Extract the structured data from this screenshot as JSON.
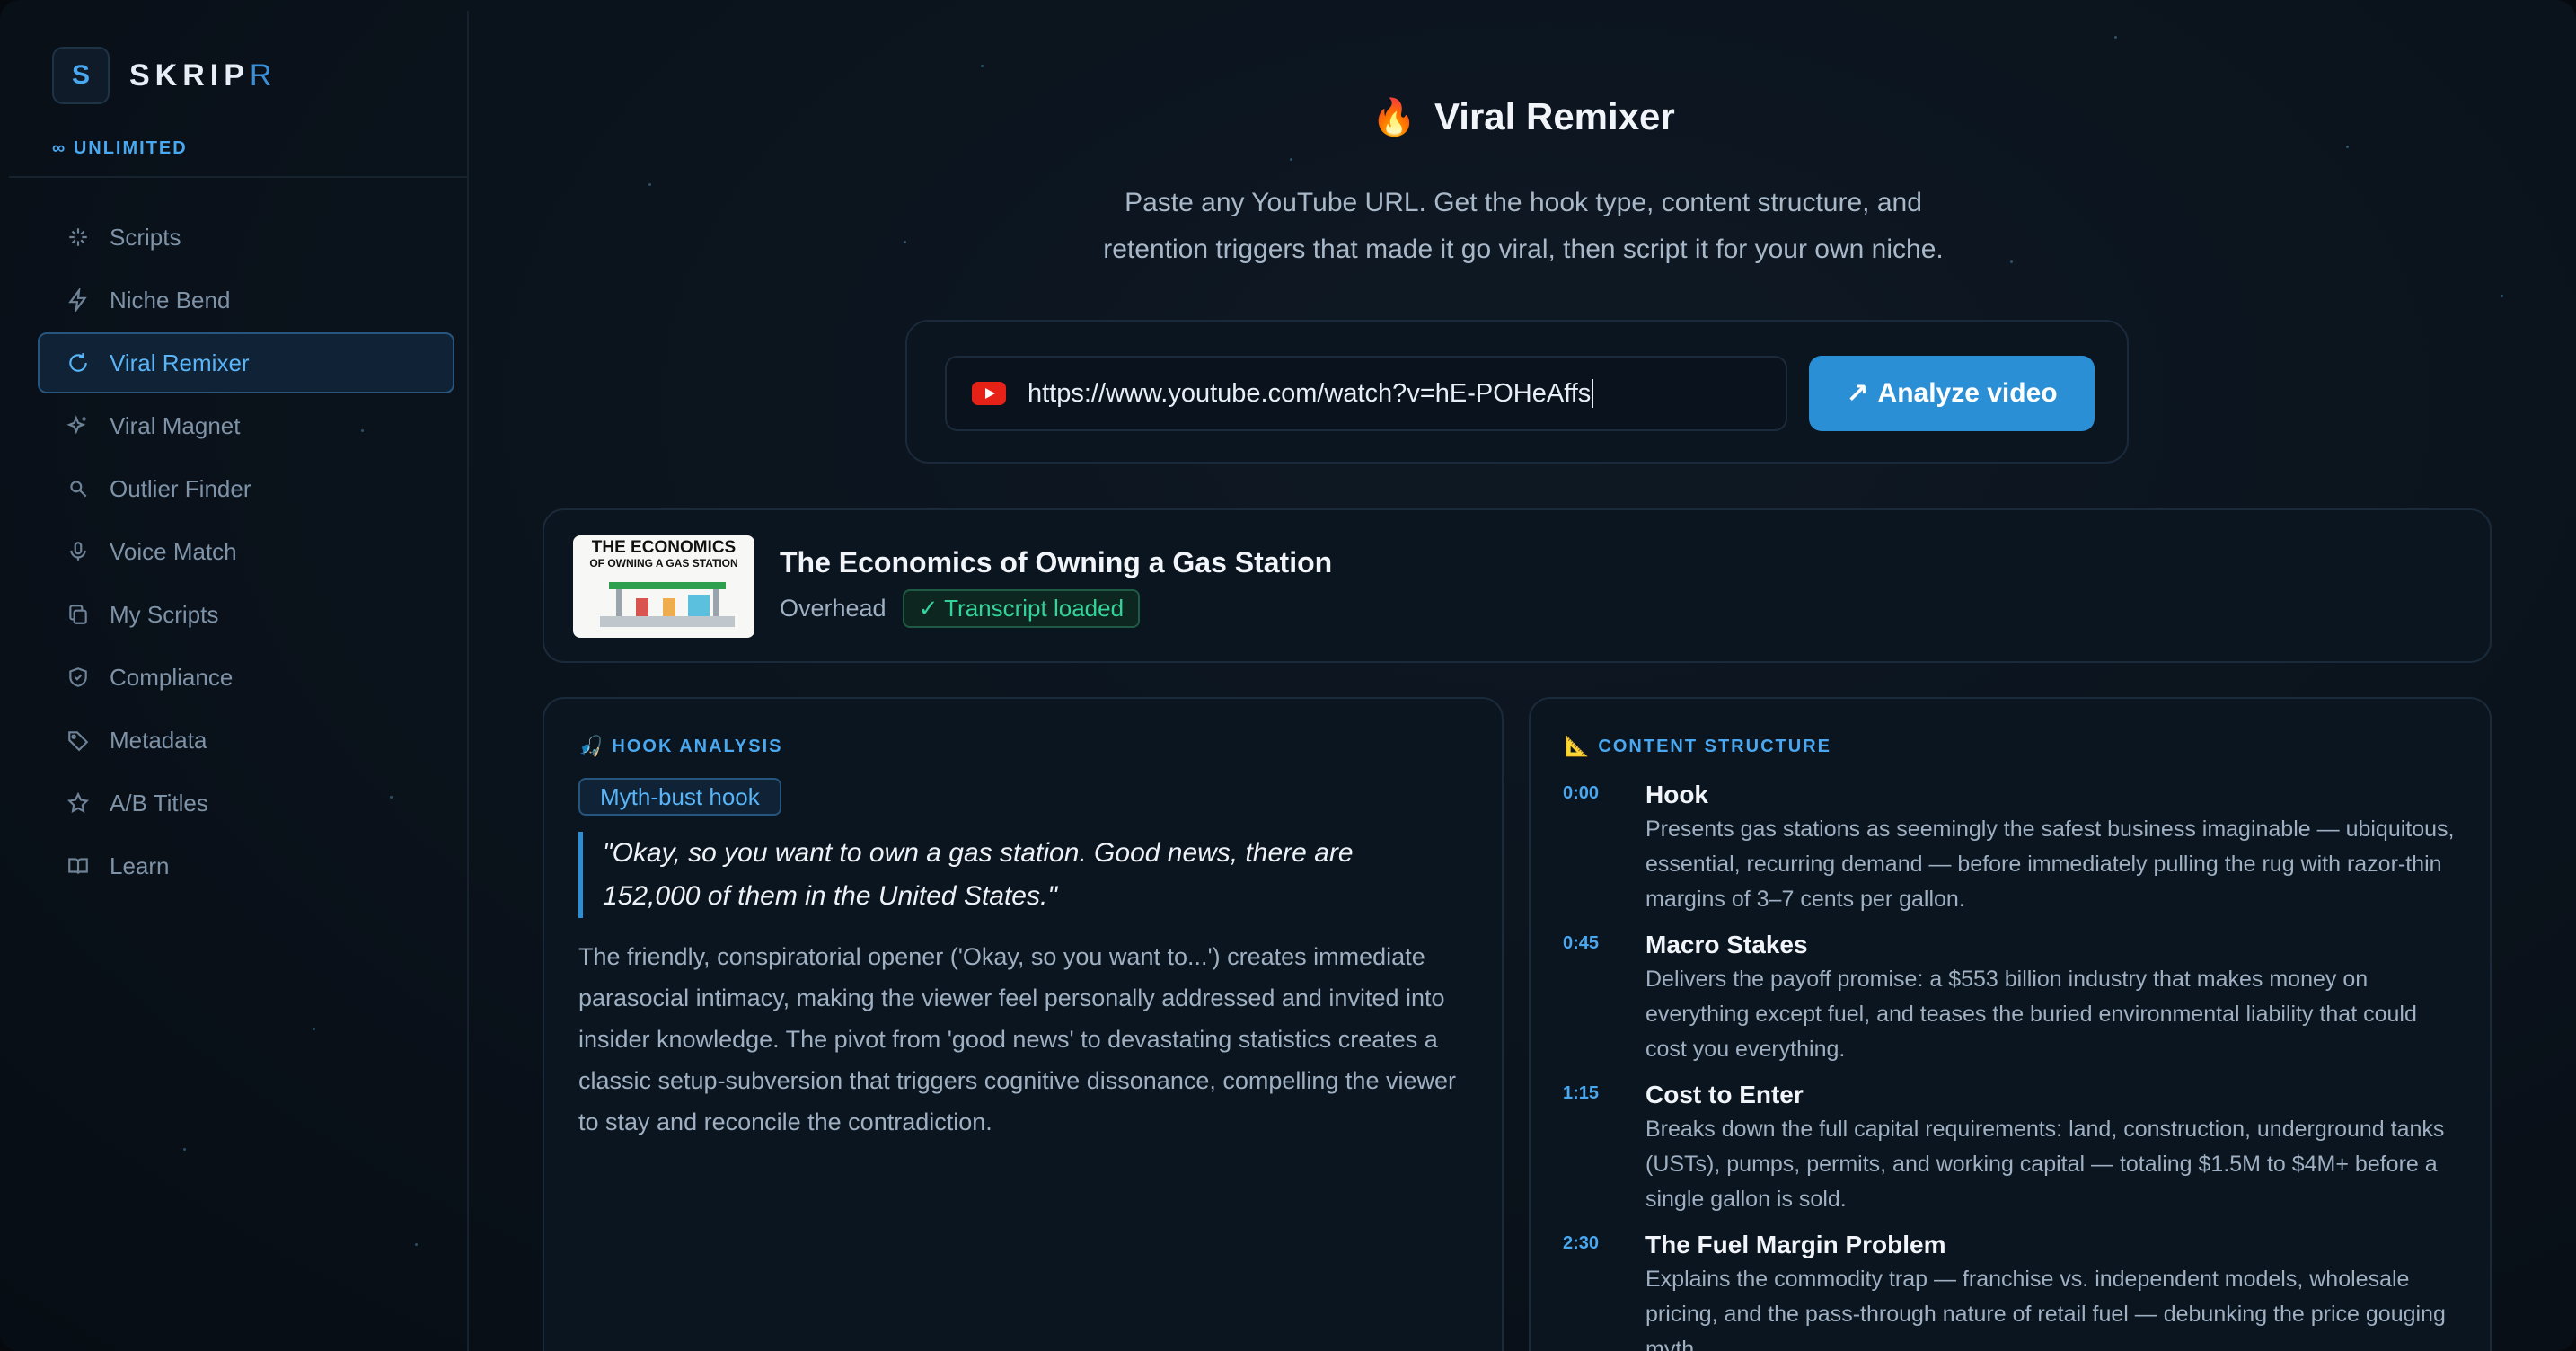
{
  "sidebar": {
    "logo_letter": "S",
    "brand_main": "SKRIP",
    "brand_accent": "R",
    "plan": "∞ UNLIMITED",
    "items": [
      {
        "label": "Scripts",
        "icon": "sparkle-icon"
      },
      {
        "label": "Niche Bend",
        "icon": "bolt-icon"
      },
      {
        "label": "Viral Remixer",
        "icon": "refresh-icon",
        "active": true
      },
      {
        "label": "Viral Magnet",
        "icon": "magic-icon"
      },
      {
        "label": "Outlier Finder",
        "icon": "search-icon"
      },
      {
        "label": "Voice Match",
        "icon": "microphone-icon"
      },
      {
        "label": "My Scripts",
        "icon": "copy-icon"
      },
      {
        "label": "Compliance",
        "icon": "shield-icon"
      },
      {
        "label": "Metadata",
        "icon": "tag-icon"
      },
      {
        "label": "A/B Titles",
        "icon": "star-icon"
      },
      {
        "label": "Learn",
        "icon": "book-icon"
      }
    ]
  },
  "header": {
    "icon": "🔥",
    "title": "Viral Remixer",
    "subtitle_line1": "Paste any YouTube URL. Get the hook type, content structure, and",
    "subtitle_line2": "retention triggers that made it go viral, then script it for your own niche."
  },
  "url_form": {
    "value": "https://www.youtube.com/watch?v=hE-POHeAffs",
    "button_arrow": "↗",
    "button_label": "Analyze video"
  },
  "video": {
    "thumb_line1": "THE ECONOMICS",
    "thumb_line2": "OF OWNING A GAS STATION",
    "title": "The Economics of Owning a Gas Station",
    "channel": "Overhead",
    "status": "✓ Transcript loaded"
  },
  "hook": {
    "heading": "HOOK ANALYSIS",
    "heading_icon": "🎣",
    "type": "Myth-bust hook",
    "quote": "\"Okay, so you want to own a gas station. Good news, there are 152,000 of them in the United States.\"",
    "explanation": "The friendly, conspiratorial opener ('Okay, so you want to...') creates immediate parasocial intimacy, making the viewer feel personally addressed and invited into insider knowledge. The pivot from 'good news' to devastating statistics creates a classic setup-subversion that triggers cognitive dissonance, compelling the viewer to stay and reconcile the contradiction."
  },
  "structure": {
    "heading": "CONTENT STRUCTURE",
    "heading_icon": "📐",
    "segments": [
      {
        "time": "0:00",
        "title": "Hook",
        "desc": "Presents gas stations as seemingly the safest business imaginable — ubiquitous, essential, recurring demand — before immediately pulling the rug with razor-thin margins of 3–7 cents per gallon."
      },
      {
        "time": "0:45",
        "title": "Macro Stakes",
        "desc": "Delivers the payoff promise: a $553 billion industry that makes money on everything except fuel, and teases the buried environmental liability that could cost you everything."
      },
      {
        "time": "1:15",
        "title": "Cost to Enter",
        "desc": "Breaks down the full capital requirements: land, construction, underground tanks (USTs), pumps, permits, and working capital — totaling $1.5M to $4M+ before a single gallon is sold."
      },
      {
        "time": "2:30",
        "title": "The Fuel Margin Problem",
        "desc": "Explains the commodity trap — franchise vs. independent models, wholesale pricing, and the pass-through nature of retail fuel — debunking the price gouging myth."
      }
    ]
  },
  "colors": {
    "accent": "#2b8fd6",
    "accent_text": "#4aa8f0",
    "success": "#34d399",
    "youtube": "#e62117"
  }
}
